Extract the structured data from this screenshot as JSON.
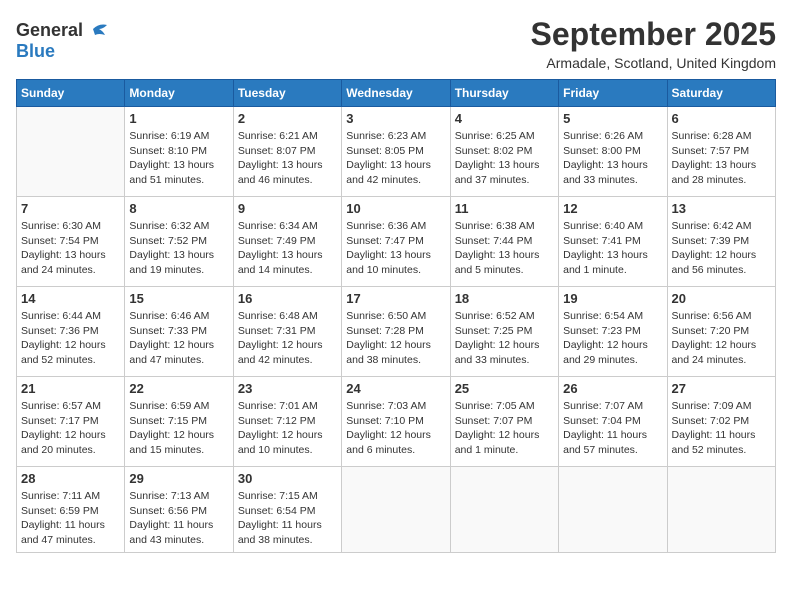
{
  "logo": {
    "general": "General",
    "blue": "Blue"
  },
  "title": "September 2025",
  "location": "Armadale, Scotland, United Kingdom",
  "days_of_week": [
    "Sunday",
    "Monday",
    "Tuesday",
    "Wednesday",
    "Thursday",
    "Friday",
    "Saturday"
  ],
  "weeks": [
    [
      {
        "day": "",
        "info": ""
      },
      {
        "day": "1",
        "info": "Sunrise: 6:19 AM\nSunset: 8:10 PM\nDaylight: 13 hours\nand 51 minutes."
      },
      {
        "day": "2",
        "info": "Sunrise: 6:21 AM\nSunset: 8:07 PM\nDaylight: 13 hours\nand 46 minutes."
      },
      {
        "day": "3",
        "info": "Sunrise: 6:23 AM\nSunset: 8:05 PM\nDaylight: 13 hours\nand 42 minutes."
      },
      {
        "day": "4",
        "info": "Sunrise: 6:25 AM\nSunset: 8:02 PM\nDaylight: 13 hours\nand 37 minutes."
      },
      {
        "day": "5",
        "info": "Sunrise: 6:26 AM\nSunset: 8:00 PM\nDaylight: 13 hours\nand 33 minutes."
      },
      {
        "day": "6",
        "info": "Sunrise: 6:28 AM\nSunset: 7:57 PM\nDaylight: 13 hours\nand 28 minutes."
      }
    ],
    [
      {
        "day": "7",
        "info": "Sunrise: 6:30 AM\nSunset: 7:54 PM\nDaylight: 13 hours\nand 24 minutes."
      },
      {
        "day": "8",
        "info": "Sunrise: 6:32 AM\nSunset: 7:52 PM\nDaylight: 13 hours\nand 19 minutes."
      },
      {
        "day": "9",
        "info": "Sunrise: 6:34 AM\nSunset: 7:49 PM\nDaylight: 13 hours\nand 14 minutes."
      },
      {
        "day": "10",
        "info": "Sunrise: 6:36 AM\nSunset: 7:47 PM\nDaylight: 13 hours\nand 10 minutes."
      },
      {
        "day": "11",
        "info": "Sunrise: 6:38 AM\nSunset: 7:44 PM\nDaylight: 13 hours\nand 5 minutes."
      },
      {
        "day": "12",
        "info": "Sunrise: 6:40 AM\nSunset: 7:41 PM\nDaylight: 13 hours\nand 1 minute."
      },
      {
        "day": "13",
        "info": "Sunrise: 6:42 AM\nSunset: 7:39 PM\nDaylight: 12 hours\nand 56 minutes."
      }
    ],
    [
      {
        "day": "14",
        "info": "Sunrise: 6:44 AM\nSunset: 7:36 PM\nDaylight: 12 hours\nand 52 minutes."
      },
      {
        "day": "15",
        "info": "Sunrise: 6:46 AM\nSunset: 7:33 PM\nDaylight: 12 hours\nand 47 minutes."
      },
      {
        "day": "16",
        "info": "Sunrise: 6:48 AM\nSunset: 7:31 PM\nDaylight: 12 hours\nand 42 minutes."
      },
      {
        "day": "17",
        "info": "Sunrise: 6:50 AM\nSunset: 7:28 PM\nDaylight: 12 hours\nand 38 minutes."
      },
      {
        "day": "18",
        "info": "Sunrise: 6:52 AM\nSunset: 7:25 PM\nDaylight: 12 hours\nand 33 minutes."
      },
      {
        "day": "19",
        "info": "Sunrise: 6:54 AM\nSunset: 7:23 PM\nDaylight: 12 hours\nand 29 minutes."
      },
      {
        "day": "20",
        "info": "Sunrise: 6:56 AM\nSunset: 7:20 PM\nDaylight: 12 hours\nand 24 minutes."
      }
    ],
    [
      {
        "day": "21",
        "info": "Sunrise: 6:57 AM\nSunset: 7:17 PM\nDaylight: 12 hours\nand 20 minutes."
      },
      {
        "day": "22",
        "info": "Sunrise: 6:59 AM\nSunset: 7:15 PM\nDaylight: 12 hours\nand 15 minutes."
      },
      {
        "day": "23",
        "info": "Sunrise: 7:01 AM\nSunset: 7:12 PM\nDaylight: 12 hours\nand 10 minutes."
      },
      {
        "day": "24",
        "info": "Sunrise: 7:03 AM\nSunset: 7:10 PM\nDaylight: 12 hours\nand 6 minutes."
      },
      {
        "day": "25",
        "info": "Sunrise: 7:05 AM\nSunset: 7:07 PM\nDaylight: 12 hours\nand 1 minute."
      },
      {
        "day": "26",
        "info": "Sunrise: 7:07 AM\nSunset: 7:04 PM\nDaylight: 11 hours\nand 57 minutes."
      },
      {
        "day": "27",
        "info": "Sunrise: 7:09 AM\nSunset: 7:02 PM\nDaylight: 11 hours\nand 52 minutes."
      }
    ],
    [
      {
        "day": "28",
        "info": "Sunrise: 7:11 AM\nSunset: 6:59 PM\nDaylight: 11 hours\nand 47 minutes."
      },
      {
        "day": "29",
        "info": "Sunrise: 7:13 AM\nSunset: 6:56 PM\nDaylight: 11 hours\nand 43 minutes."
      },
      {
        "day": "30",
        "info": "Sunrise: 7:15 AM\nSunset: 6:54 PM\nDaylight: 11 hours\nand 38 minutes."
      },
      {
        "day": "",
        "info": ""
      },
      {
        "day": "",
        "info": ""
      },
      {
        "day": "",
        "info": ""
      },
      {
        "day": "",
        "info": ""
      }
    ]
  ]
}
